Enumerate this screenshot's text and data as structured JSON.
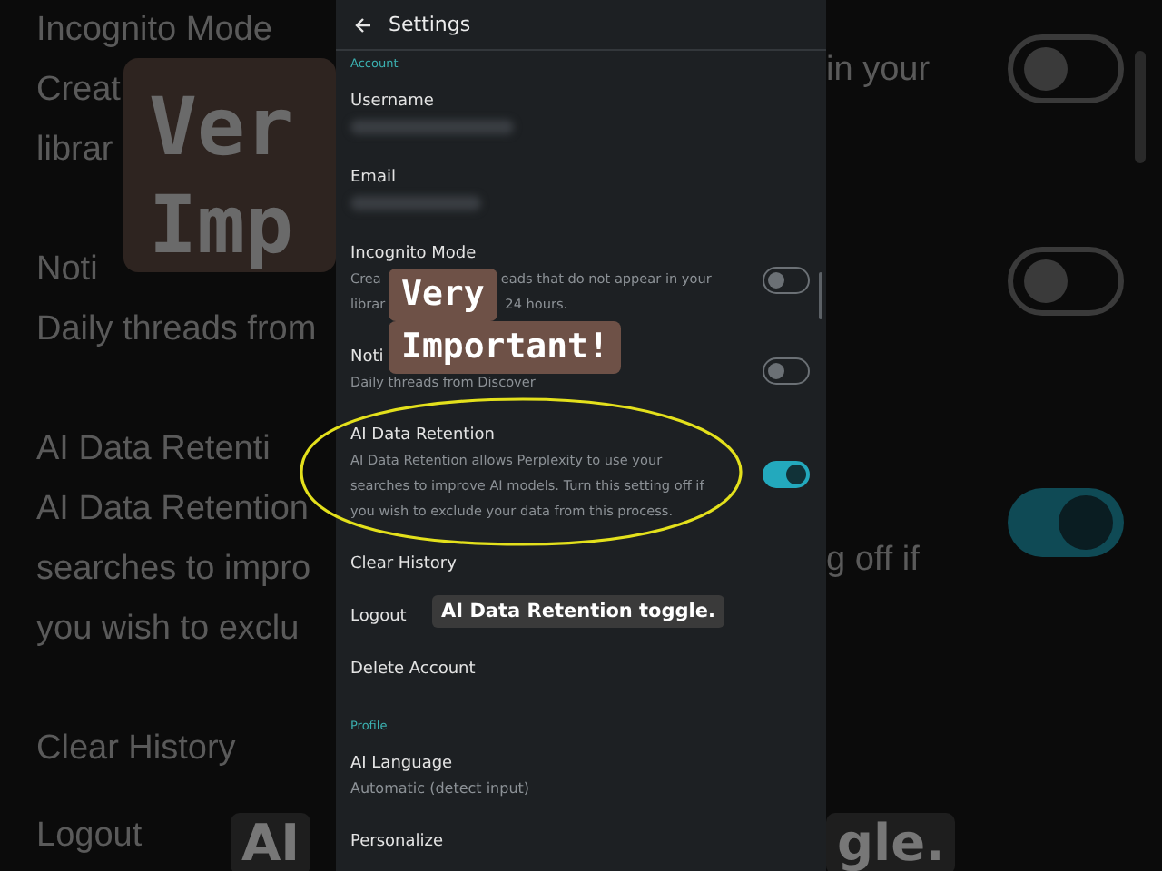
{
  "backdrop": {
    "left": [
      [
        "Incognito Mode",
        "Creat",
        "librar"
      ],
      [
        "Noti",
        "Daily threads from"
      ],
      [
        "AI Data Retenti",
        "AI Data Retention",
        "searches to impro",
        "you wish to exclu"
      ],
      [
        "Clear History"
      ],
      [
        "Logout"
      ]
    ],
    "left_caption": [
      "Ver",
      "Imp"
    ],
    "left_bottom_caption": "AI",
    "right": [
      {
        "text": "in your",
        "on": false
      },
      {
        "on": false
      },
      {
        "text": "g off if",
        "on": true
      }
    ],
    "right_bottom_caption": "gle."
  },
  "header": {
    "title": "Settings"
  },
  "sections": [
    {
      "heading": "Account",
      "items": [
        {
          "kind": "value",
          "title": "Username"
        },
        {
          "kind": "value",
          "title": "Email"
        },
        {
          "kind": "toggle",
          "title": "Incognito Mode",
          "description": [
            [
              "Crea",
              "eads that do not appear in your"
            ],
            [
              "librar",
              "24 hours."
            ]
          ],
          "on": false
        },
        {
          "kind": "toggle",
          "title": "Noti",
          "description": [
            [
              "Daily threads from Discover"
            ]
          ],
          "on": false
        },
        {
          "kind": "toggle",
          "title": "AI Data Retention",
          "description": [
            [
              "AI Data Retention allows Perplexity to use your"
            ],
            [
              "searches to improve AI models. Turn this setting off if"
            ],
            [
              "you wish to exclude your data from this process."
            ]
          ],
          "on": true
        },
        {
          "kind": "action",
          "title": "Clear History"
        },
        {
          "kind": "action",
          "title": "Logout"
        },
        {
          "kind": "action",
          "title": "Delete Account"
        }
      ]
    },
    {
      "heading": "Profile",
      "items": [
        {
          "kind": "value",
          "title": "AI Language",
          "value": "Automatic (detect input)"
        },
        {
          "kind": "action",
          "title": "Personalize"
        }
      ]
    }
  ],
  "captions": [
    {
      "kind": "highlight",
      "lines": [
        "Very",
        "Important!"
      ]
    },
    {
      "kind": "subtitle",
      "text": "AI Data Retention toggle."
    }
  ]
}
